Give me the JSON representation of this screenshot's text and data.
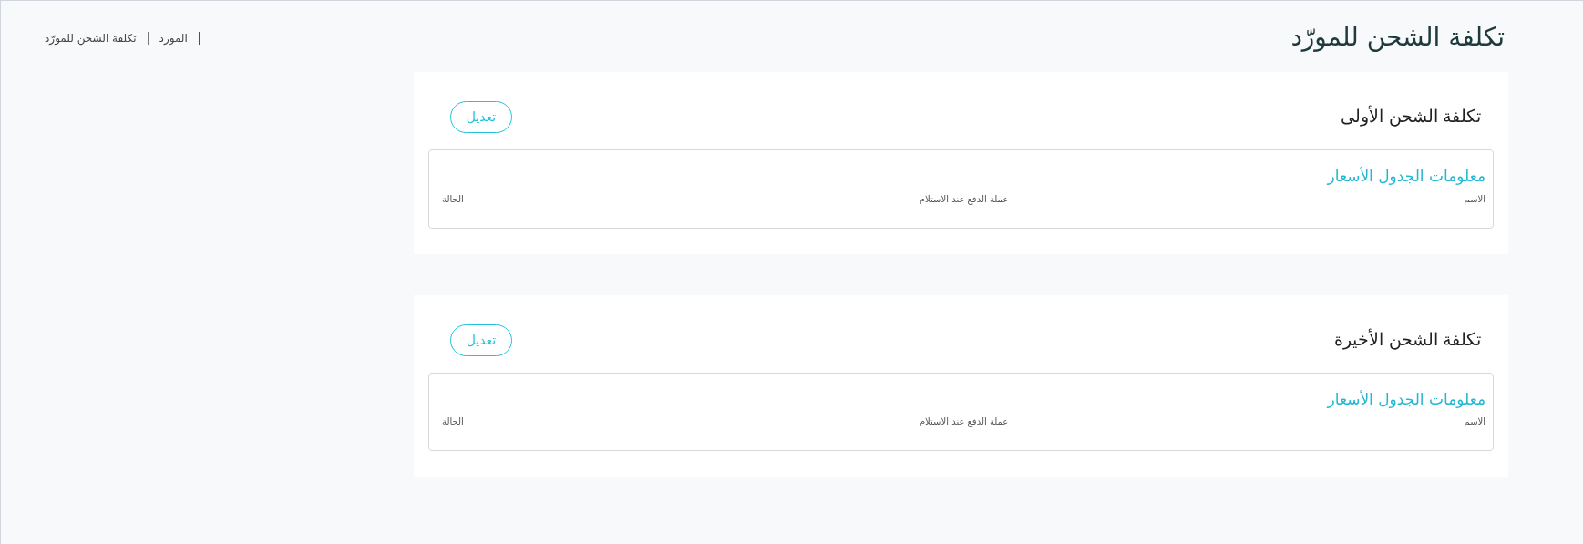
{
  "page_title": "تكلفة الشحن للمورّد",
  "breadcrumb": [
    "المورد",
    "تكلفة الشحن للمورّد"
  ],
  "sections": [
    {
      "title": "تكلفة الشحن الأولى",
      "edit_button": "تعديل",
      "table": {
        "title": "معلومات الجدول الأسعار",
        "columns": [
          "الاسم",
          "عملة الدفع عند الاستلام",
          "الحالة"
        ]
      }
    },
    {
      "title": "تكلفة الشحن الأخيرة",
      "edit_button": "تعديل",
      "table": {
        "title": "معلومات الجدول الأسعار",
        "columns": [
          "الاسم",
          "عملة الدفع عند الاستلام",
          "الحالة"
        ]
      }
    }
  ]
}
